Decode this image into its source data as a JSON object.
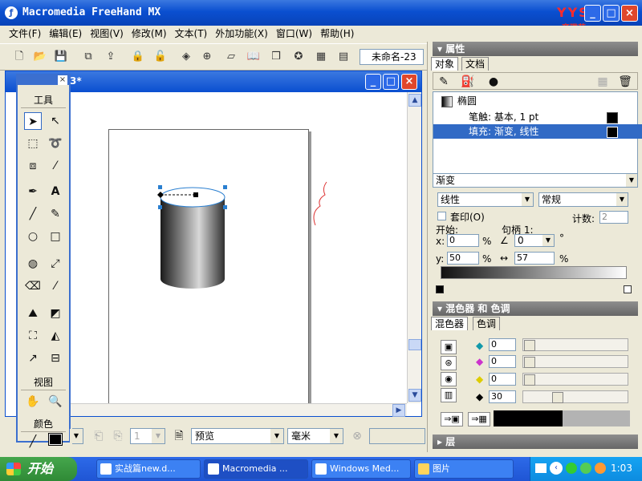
{
  "window": {
    "title": "Macromedia FreeHand MX",
    "logo_text": "YYS",
    "logo_sub": "育碟苑"
  },
  "menu": [
    "文件(F)",
    "编辑(E)",
    "视图(V)",
    "修改(M)",
    "文本(T)",
    "外加功能(X)",
    "窗口(W)",
    "帮助(H)"
  ],
  "toolbar": {
    "icons": [
      "new-icon",
      "open-icon",
      "save-icon",
      "import-icon",
      "export-icon",
      "lock-icon",
      "unlock-icon",
      "group-icon",
      "ungroup-icon",
      "align-icon",
      "text-icon",
      "layers-icon",
      "styles-icon",
      "swatches-icon",
      "library-icon"
    ],
    "document_select": "未命名-23"
  },
  "document": {
    "title_suffix": "3*"
  },
  "tools_panel": {
    "header": "工具",
    "view_label": "视图",
    "color_label": "颜色"
  },
  "statusbar": {
    "page_field": "1",
    "view_mode": "预览",
    "units": "毫米"
  },
  "properties": {
    "title": "属性",
    "tabs": [
      "对象",
      "文档"
    ],
    "objects": [
      {
        "label": "椭圆"
      },
      {
        "label": "笔触: 基本, 1 pt"
      },
      {
        "label": "填充: 渐变, 线性"
      }
    ],
    "fill_type": "渐变",
    "gradient_type": "线性",
    "gradient_mode": "常规",
    "overprint_label": "套印(O)",
    "count_label": "计数:",
    "count_value": "2",
    "start_label": "开始:",
    "handle_label": "句柄 1:",
    "x_label": "x:",
    "x_value": "0",
    "y_label": "y:",
    "y_value": "50",
    "angle_value": "0",
    "distance_value": "57",
    "percent": "%",
    "degree": "°"
  },
  "mixer": {
    "title": "混色器 和 色调",
    "tabs": [
      "混色器",
      "色调"
    ],
    "values": [
      "0",
      "0",
      "0",
      "30"
    ],
    "fractions": [
      0.0,
      0.0,
      0.0,
      0.3
    ]
  },
  "layers": {
    "title": "层"
  },
  "taskbar": {
    "start": "开始",
    "tasks": [
      "实战篇new.d...",
      "Macromedia ...",
      "Windows Med...",
      "图片"
    ],
    "clock": "1:03"
  },
  "colors": {
    "accent": "#0a4fd0",
    "selection": "#316ac5"
  }
}
